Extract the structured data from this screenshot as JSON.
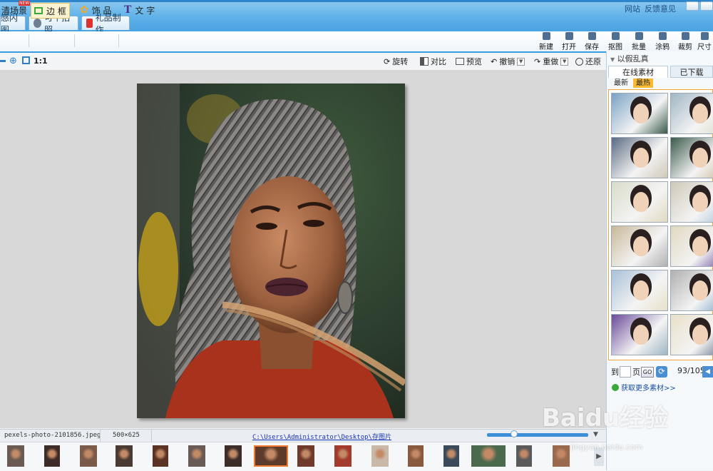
{
  "tabs": [
    {
      "label": "感闪图"
    },
    {
      "label": "可牛拍照"
    },
    {
      "label": "礼品制作"
    }
  ],
  "top_links": [
    "网站",
    "反馈意见"
  ],
  "toolbar": {
    "left_tools": [
      {
        "label": "清场景",
        "badge": "NEW"
      },
      {
        "label": "边 框"
      },
      {
        "label": "饰 品"
      },
      {
        "label": "文 字"
      }
    ],
    "right_buttons": [
      "新建",
      "打开",
      "保存",
      "抠图",
      "批量",
      "涂鸦",
      "裁剪",
      "尺寸"
    ]
  },
  "editbar": {
    "zoom_label": "1:1",
    "buttons": [
      "旋转",
      "对比",
      "预览",
      "撤销",
      "重做",
      "还原"
    ]
  },
  "status": {
    "filename": "pexels-photo-2101856.jpeg",
    "dimensions": "500×625",
    "path": "C:\\Users\\Administrator\\Desktop\\存图片"
  },
  "zoom_level": 0.25,
  "filmstrip": {
    "count": 17,
    "selected_index": 7
  },
  "right_panel": {
    "header": "以假乱真",
    "tabs": [
      "在线素材",
      "已下载"
    ],
    "sub_tabs": [
      "最新",
      "最热"
    ],
    "page_label_to": "到",
    "page_label_page": "页",
    "go_label": "GO",
    "page_count": "93/105",
    "more_link": "获取更多素材>>"
  },
  "watermark": {
    "brand": "Baidu经验",
    "url": "jingyan.baidu.com"
  },
  "colors": {
    "title_bar": "#5fb1e8",
    "accent": "#3b9be0",
    "selected_thumb": "#f07b30",
    "active_subtab": "#f9b931"
  }
}
